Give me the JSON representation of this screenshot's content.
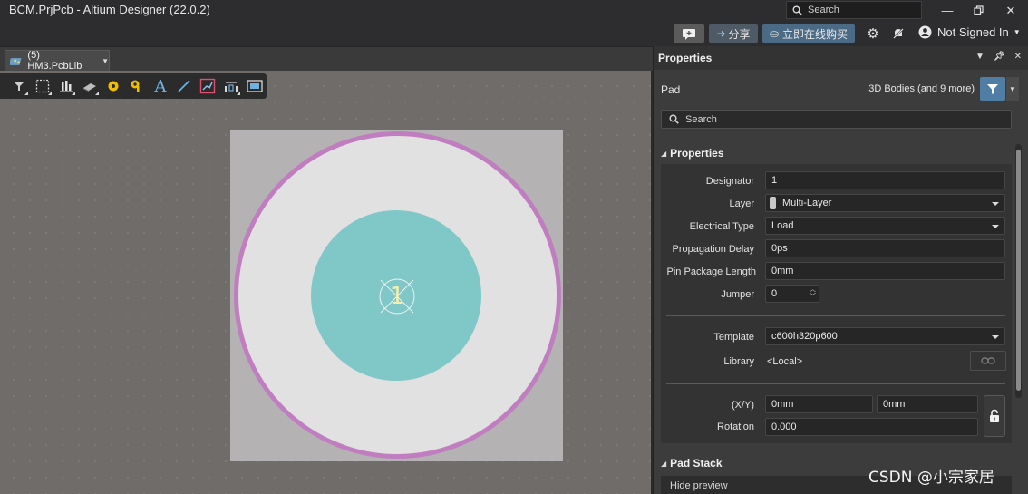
{
  "window": {
    "title": "BCM.PrjPcb - Altium Designer (22.0.2)",
    "search_placeholder": "Search"
  },
  "cmdbar": {
    "share_label": "分享",
    "buy_label": "立即在线购买",
    "signin_label": "Not Signed In"
  },
  "document_tab": {
    "label": "(5) HM3.PcbLib"
  },
  "canvas": {
    "pad_designator": "1"
  },
  "panel": {
    "title": "Properties",
    "object_type": "Pad",
    "filter_text": "3D Bodies (and 9 more)",
    "search_placeholder": "Search",
    "section_properties": "Properties",
    "section_padstack": "Pad Stack",
    "hide_preview": "Hide preview",
    "props": {
      "designator_label": "Designator",
      "designator_value": "1",
      "layer_label": "Layer",
      "layer_value": "Multi-Layer",
      "electrical_label": "Electrical Type",
      "electrical_value": "Load",
      "propdelay_label": "Propagation Delay",
      "propdelay_value": "0ps",
      "pinpkg_label": "Pin Package Length",
      "pinpkg_value": "0mm",
      "jumper_label": "Jumper",
      "jumper_value": "0",
      "template_label": "Template",
      "template_value": "c600h320p600",
      "library_label": "Library",
      "library_value": "<Local>",
      "xy_label": "(X/Y)",
      "x_value": "0mm",
      "y_value": "0mm",
      "rotation_label": "Rotation",
      "rotation_value": "0.000"
    }
  },
  "watermark": "CSDN @小宗家居",
  "colors": {
    "accent": "#4f7da3",
    "pad_ring": "#c07ec0",
    "pad_hole": "#80c8c8",
    "canvas": "#706c6a"
  }
}
